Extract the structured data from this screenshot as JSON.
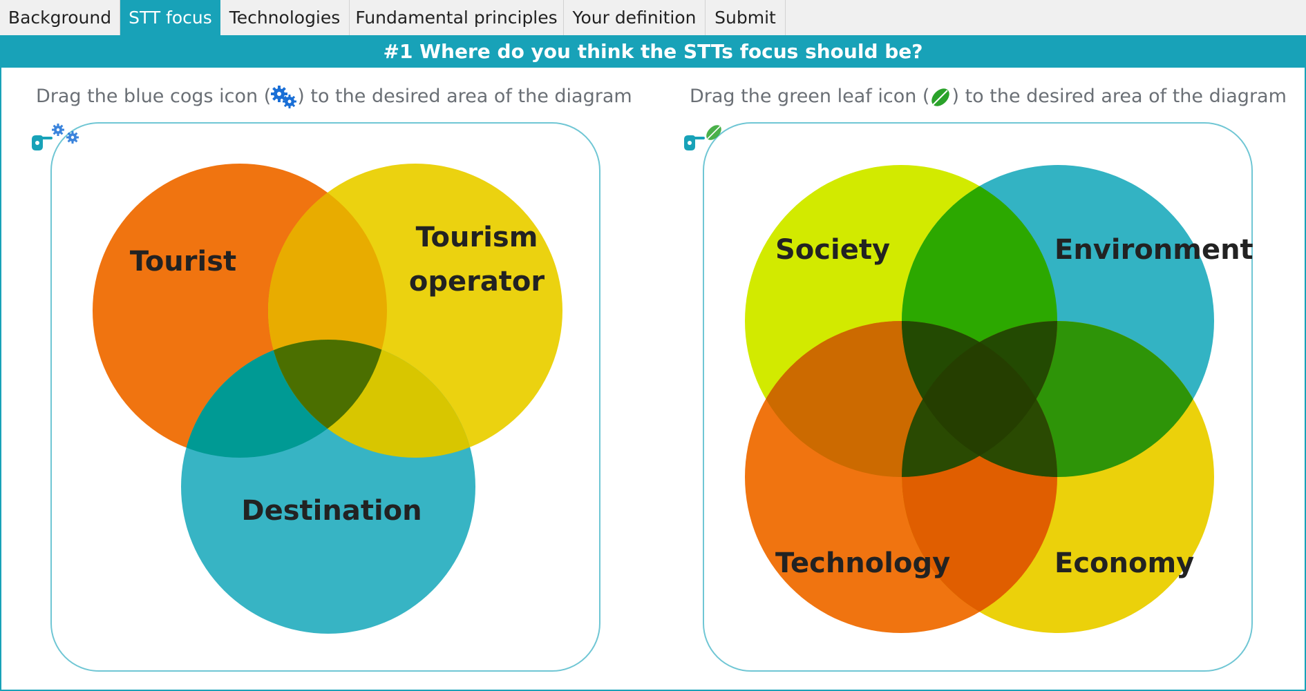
{
  "tabs": [
    {
      "label": "Background",
      "active": false
    },
    {
      "label": "STT focus",
      "active": true
    },
    {
      "label": "Technologies",
      "active": false
    },
    {
      "label": "Fundamental principles",
      "active": false
    },
    {
      "label": "Your definition",
      "active": false
    },
    {
      "label": "Submit",
      "active": false
    }
  ],
  "question": {
    "title": "#1 Where do you think the STTs focus should be?"
  },
  "left": {
    "instruction_before": "Drag the blue cogs icon (",
    "instruction_after": ") to the desired area of the diagram",
    "icon": "blue-cogs-icon",
    "icon_color": "#1a6fd6",
    "labels": {
      "tourist": "Tourist",
      "operator_line1": "Tourism",
      "operator_line2": "operator",
      "destination": "Destination"
    },
    "colors": {
      "tourist": "#f07410",
      "operator": "#ebd10b",
      "destination": "#33b3c3"
    }
  },
  "right": {
    "instruction_before": "Drag the green leaf icon (",
    "instruction_after": ") to the desired area of the diagram",
    "icon": "green-leaf-icon",
    "icon_color": "#2aa22a",
    "labels": {
      "society": "Society",
      "environment": "Environment",
      "technology": "Technology",
      "economy": "Economy"
    },
    "colors": {
      "society": "#d2ea00",
      "environment": "#33b3c3",
      "technology": "#f07410",
      "economy": "#ebd10b"
    }
  },
  "theme": {
    "accent": "#18a2b8",
    "border": "#6fc6d4"
  }
}
